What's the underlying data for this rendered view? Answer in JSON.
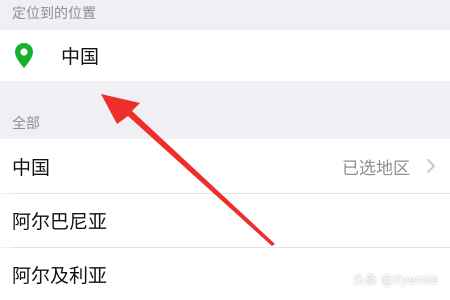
{
  "sections": {
    "located_header": "定位到的位置",
    "all_header": "全部"
  },
  "located": {
    "label": "中国",
    "icon": "location-pin-icon"
  },
  "regions": [
    {
      "label": "中国",
      "status": "已选地区"
    },
    {
      "label": "阿尔巴尼亚"
    },
    {
      "label": "阿尔及利亚"
    }
  ],
  "watermark": {
    "text": "头条 @Xyemie"
  },
  "colors": {
    "pin": "#16b22f",
    "arrow": "#ef2d2d",
    "background": "#efeff4",
    "row": "#ffffff",
    "secondary_text": "#8e8e93"
  }
}
